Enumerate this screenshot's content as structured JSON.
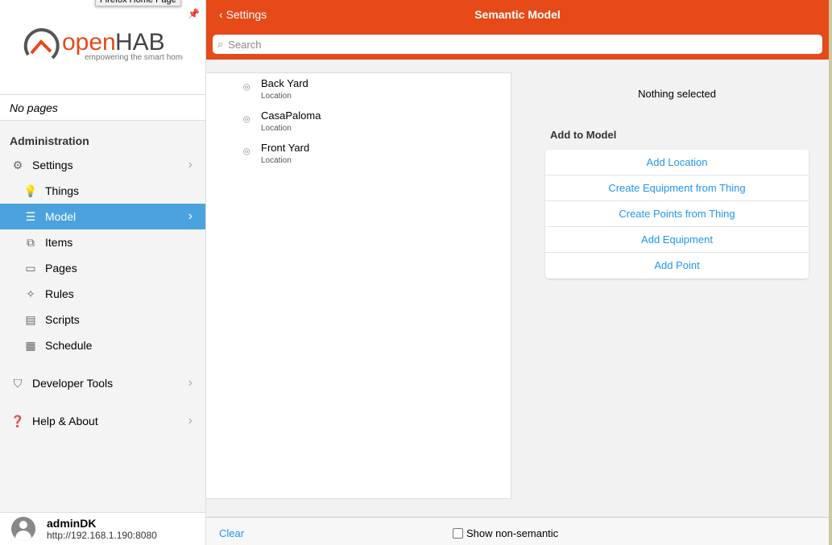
{
  "tooltip": "Firefox Home Page",
  "logo": {
    "name_open": "open",
    "name_hab": "HAB",
    "tagline": "empowering the smart home"
  },
  "sidebar": {
    "no_pages": "No pages",
    "section": "Administration",
    "settings": "Settings",
    "items": [
      {
        "label": "Things"
      },
      {
        "label": "Model"
      },
      {
        "label": "Items"
      },
      {
        "label": "Pages"
      },
      {
        "label": "Rules"
      },
      {
        "label": "Scripts"
      },
      {
        "label": "Schedule"
      }
    ],
    "developer_tools": "Developer Tools",
    "help": "Help & About",
    "user": {
      "name": "adminDK",
      "url": "http://192.168.1.190:8080"
    }
  },
  "header": {
    "back": "Settings",
    "title": "Semantic Model",
    "search_placeholder": "Search"
  },
  "tree": [
    {
      "name": "Back Yard",
      "type": "Location"
    },
    {
      "name": "CasaPaloma",
      "type": "Location"
    },
    {
      "name": "Front Yard",
      "type": "Location"
    }
  ],
  "detail": {
    "nothing": "Nothing selected",
    "add_to_model": "Add to Model",
    "actions": [
      "Add Location",
      "Create Equipment from Thing",
      "Create Points from Thing",
      "Add Equipment",
      "Add Point"
    ]
  },
  "footer": {
    "clear": "Clear",
    "show_non_semantic": "Show non-semantic"
  },
  "colors": {
    "brand": "#e64a19",
    "active": "#4aa3df",
    "link": "#2196f3"
  }
}
